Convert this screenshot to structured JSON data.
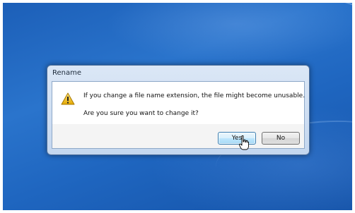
{
  "desktop": {
    "wallpaper_color": "#1f66c0"
  },
  "dialog": {
    "title": "Rename",
    "icon": "warning-triangle-icon",
    "message_line1": "If you change a file name extension, the file might become unusable.",
    "message_line2": "Are you sure you want to change it?",
    "buttons": {
      "yes_label": "Yes",
      "no_label": "No"
    },
    "focused_button": "Yes"
  },
  "pointer": {
    "icon": "hand-pointer-icon"
  }
}
